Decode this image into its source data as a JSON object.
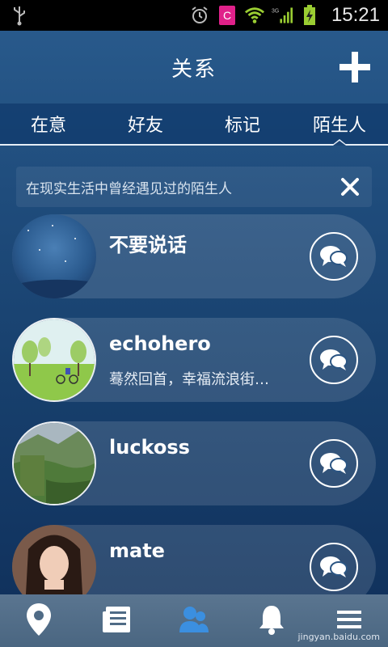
{
  "statusbar": {
    "time": "15:21"
  },
  "header": {
    "title": "关系"
  },
  "tabs": [
    {
      "label": "在意"
    },
    {
      "label": "好友"
    },
    {
      "label": "标记"
    },
    {
      "label": "陌生人"
    }
  ],
  "banner": {
    "text": "在现实生活中曾经遇见过的陌生人"
  },
  "contacts": [
    {
      "name": "不要说话",
      "message": ""
    },
    {
      "name": "echohero",
      "message": "蓦然回首，幸福流浪街…"
    },
    {
      "name": "luckoss",
      "message": ""
    },
    {
      "name": "mate",
      "message": ""
    }
  ],
  "watermark": {
    "text": "jingyan.baidu.com"
  },
  "colors": {
    "accent": "#3b8fe0",
    "background": "#1f4c7c"
  }
}
